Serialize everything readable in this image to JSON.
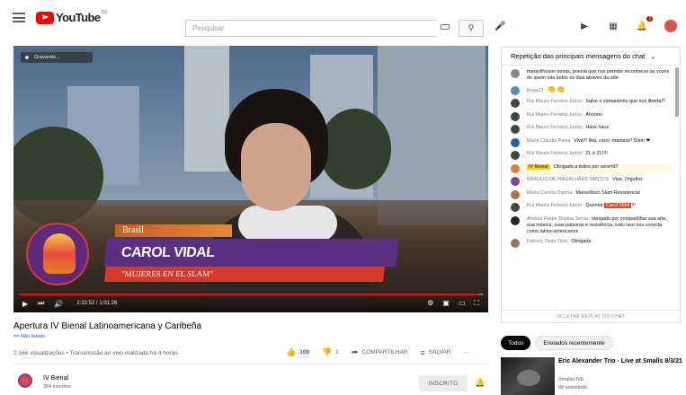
{
  "header": {
    "logo_text": "YouTube",
    "region": "BR",
    "search_placeholder": "Pesquisar",
    "notifications_badge": "3"
  },
  "video": {
    "recording_label": "Gravando...",
    "country_tag": "Brasil",
    "name_tag": "CAROL VIDAL",
    "subtitle_tag": "\"MUJERES EN EL SLAM\"",
    "time": "2:22:52 / 1:01:26",
    "progress_fraction": 0.99
  },
  "info": {
    "title": "Apertura IV Bienal Latinoamericana y Caribeña",
    "hashtag": "== Não listado",
    "views": "2.166 visualizações • Transmissão ao vivo realizada há 4 horas",
    "likes": "100",
    "dislikes": "1",
    "share": "COMPARTILHAR",
    "save": "SALVAR",
    "more": "···"
  },
  "channel": {
    "name": "IV Bienal",
    "subs": "384 inscritos",
    "subscribe": "INSCRITO"
  },
  "chat": {
    "header": "Repetição das principais mensagens do chat",
    "replay_hide": "OCULTAR REPLAY DO CHAT",
    "messages": [
      {
        "author": "",
        "text": "maravilhosos trovas, poesia que nos permite reconhecer as vozes de quem luta todos os dias através da arte"
      },
      {
        "author": "jkuga21",
        "text": "👏👏"
      },
      {
        "author": "Rui Mauro Ferreira Junior",
        "text": "Salve o xamanismo que nos liberta!!!"
      },
      {
        "author": "Rui Mauro Ferreira Junior",
        "text": "Ahoooo"
      },
      {
        "author": "Rui Mauro Ferreira Junior",
        "text": "Haux haux"
      },
      {
        "author": "Maria Cláudia Paiva",
        "text": "Viva!!! Ilka, carol, mariana!! Slam ❤"
      },
      {
        "author": "Rui Mauro Ferreira Junior",
        "text": "ZL é ZL!!!!"
      },
      {
        "author": "IV Bienal",
        "text": "Obrigado a todos por seremI!!"
      },
      {
        "author": "BRAULIO DE MAGALHÃES SANTOS",
        "text": "Viva. Orgulho."
      },
      {
        "author": "Maria Camila Ospina",
        "text": "Maravilloso Slam Resistencia!"
      },
      {
        "author": "Rui Mauro Ferreira Junior",
        "text": "Querida",
        "highlight": "Carol Vidal",
        "tail": "!!!"
      },
      {
        "author": "Andrea Felipe Ospina Serna",
        "text": "obrigado por compartilhar sua arte, sua música, suas palavras e resistência, tudo isso nos conecta como latino-americanos"
      },
      {
        "author": "Fatoury Daza Ortiz",
        "text": "Obrigada"
      }
    ]
  },
  "sidebar": {
    "chip_all": "Todos",
    "chip_recent": "Enviados recentemente",
    "rec_title": "Eric Alexander Trio - Live at Smalls 8/3/21",
    "rec_channel": "SmallsLIVE",
    "rec_watching": "68 assistindo"
  },
  "colors": {
    "brand_red": "#ff0000",
    "like_blue": "#065fd4",
    "name_banner": "#5b2f80",
    "sub_banner": "#d63a2a",
    "country_banner": "#e18a3b"
  }
}
